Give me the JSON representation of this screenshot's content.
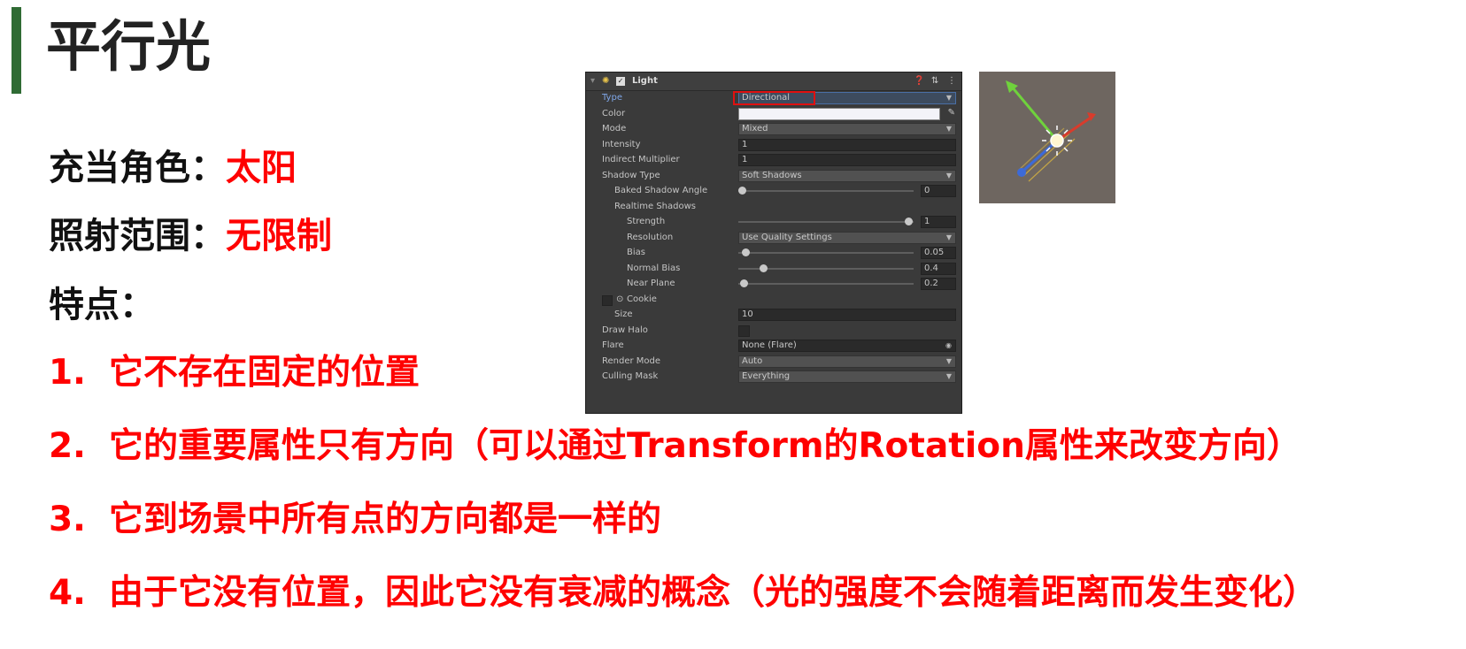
{
  "title": "平行光",
  "role": {
    "label": "充当角色：",
    "value": "太阳"
  },
  "range": {
    "label": "照射范围：",
    "value": "无限制"
  },
  "features_label": "特点：",
  "items": [
    {
      "num": "1.",
      "text": "它不存在固定的位置"
    },
    {
      "num": "2.",
      "text": "它的重要属性只有方向（可以通过Transform的Rotation属性来改变方向）"
    },
    {
      "num": "3.",
      "text": "它到场景中所有点的方向都是一样的"
    },
    {
      "num": "4.",
      "text": "由于它没有位置，因此它没有衰减的概念（光的强度不会随着距离而发生变化）"
    }
  ],
  "inspector": {
    "header": "Light",
    "type_label": "Type",
    "type_value": "Directional",
    "color_label": "Color",
    "mode_label": "Mode",
    "mode_value": "Mixed",
    "intensity_label": "Intensity",
    "intensity_value": "1",
    "indirect_label": "Indirect Multiplier",
    "indirect_value": "1",
    "shadow_type_label": "Shadow Type",
    "shadow_type_value": "Soft Shadows",
    "baked_angle_label": "Baked Shadow Angle",
    "baked_angle_value": "0",
    "realtime_label": "Realtime Shadows",
    "strength_label": "Strength",
    "strength_value": "1",
    "resolution_label": "Resolution",
    "resolution_value": "Use Quality Settings",
    "bias_label": "Bias",
    "bias_value": "0.05",
    "normal_bias_label": "Normal Bias",
    "normal_bias_value": "0.4",
    "near_plane_label": "Near Plane",
    "near_plane_value": "0.2",
    "cookie_label": "Cookie",
    "size_label": "Size",
    "size_value": "10",
    "draw_halo_label": "Draw Halo",
    "flare_label": "Flare",
    "flare_value": "None (Flare)",
    "render_mode_label": "Render Mode",
    "render_mode_value": "Auto",
    "culling_label": "Culling Mask",
    "culling_value": "Everything"
  },
  "colors": {
    "accent_bar": "#2f6b34",
    "highlight_red": "#ff0000",
    "panel_bg": "#3a3a3a"
  }
}
